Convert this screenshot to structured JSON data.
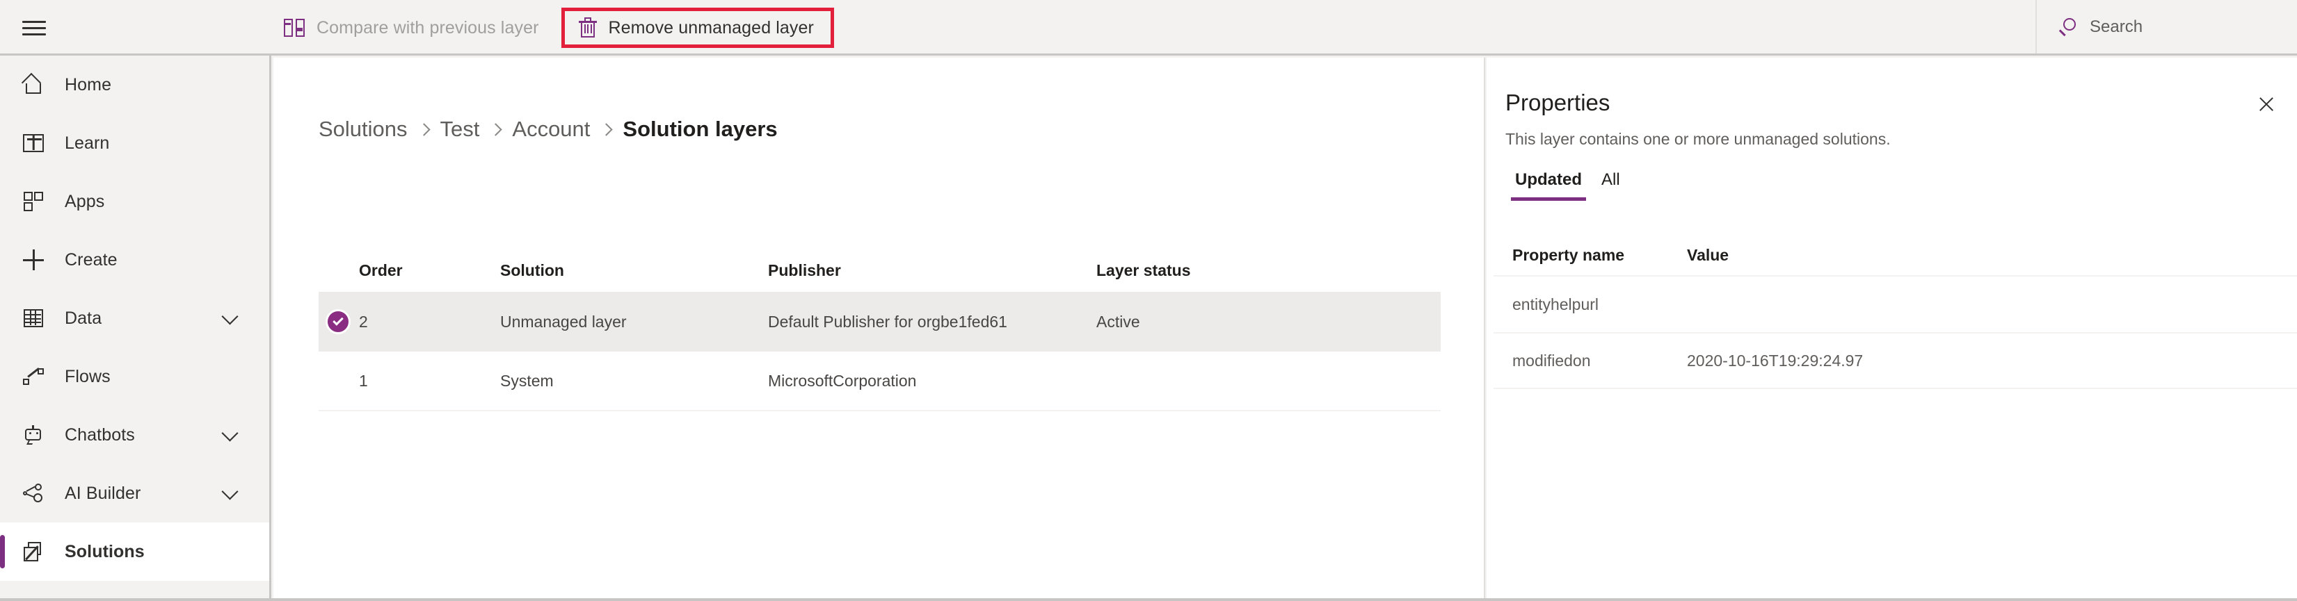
{
  "topbar": {
    "menu_icon": "hamburger-icon",
    "commands": [
      {
        "label": "Compare with previous layer",
        "icon": "compare-icon",
        "disabled": true,
        "highlighted": false
      },
      {
        "label": "Remove unmanaged layer",
        "icon": "trash-icon",
        "disabled": false,
        "highlighted": true
      }
    ],
    "search": {
      "placeholder": "Search",
      "icon": "search-icon"
    },
    "highlight_color": "#e3203c"
  },
  "sidebar": {
    "accent_color": "#7d2f82",
    "items": [
      {
        "label": "Home",
        "icon": "home-icon",
        "chevron": false,
        "active": false
      },
      {
        "label": "Learn",
        "icon": "book-icon",
        "chevron": false,
        "active": false
      },
      {
        "label": "Apps",
        "icon": "apps-icon",
        "chevron": false,
        "active": false
      },
      {
        "label": "Create",
        "icon": "plus-icon",
        "chevron": false,
        "active": false
      },
      {
        "label": "Data",
        "icon": "table-icon",
        "chevron": true,
        "active": false
      },
      {
        "label": "Flows",
        "icon": "flow-icon",
        "chevron": false,
        "active": false
      },
      {
        "label": "Chatbots",
        "icon": "bot-icon",
        "chevron": true,
        "active": false
      },
      {
        "label": "AI Builder",
        "icon": "ai-icon",
        "chevron": true,
        "active": false
      },
      {
        "label": "Solutions",
        "icon": "solution-icon",
        "chevron": false,
        "active": true
      }
    ]
  },
  "main": {
    "breadcrumb": [
      {
        "label": "Solutions",
        "current": false
      },
      {
        "label": "Test",
        "current": false
      },
      {
        "label": "Account",
        "current": false
      },
      {
        "label": "Solution layers",
        "current": true
      }
    ],
    "table": {
      "columns": [
        "Order",
        "Solution",
        "Publisher",
        "Layer status"
      ],
      "rows": [
        {
          "selected": true,
          "order": "2",
          "solution": "Unmanaged layer",
          "publisher": "Default Publisher for orgbe1fed61",
          "status": "Active"
        },
        {
          "selected": false,
          "order": "1",
          "solution": "System",
          "publisher": "MicrosoftCorporation",
          "status": ""
        }
      ]
    }
  },
  "properties": {
    "title": "Properties",
    "subtitle": "This layer contains one or more unmanaged solutions.",
    "close_icon": "close-icon",
    "tabs": [
      {
        "label": "Updated",
        "active": true
      },
      {
        "label": "All",
        "active": false
      }
    ],
    "tab_underline_color": "#7d2f82",
    "table": {
      "columns": [
        "Property name",
        "Value"
      ],
      "rows": [
        {
          "name": "entityhelpurl",
          "value": ""
        },
        {
          "name": "modifiedon",
          "value": "2020-10-16T19:29:24.97"
        }
      ]
    }
  }
}
